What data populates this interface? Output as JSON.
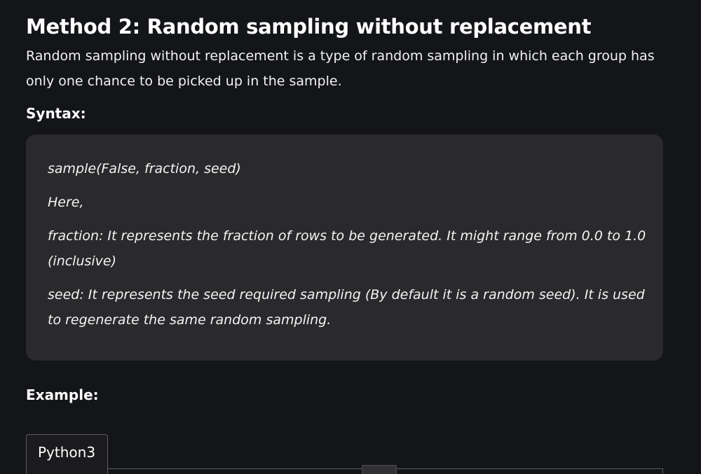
{
  "section": {
    "heading": "Method 2: Random sampling without replacement",
    "intro": "Random sampling without replacement is a type of random sampling in which each group has only one chance to be picked up in the sample."
  },
  "syntax": {
    "label": "Syntax:",
    "signature": "sample(False, fraction, seed)",
    "here": "Here,",
    "fraction_description": "fraction: It represents the fraction of rows to be generated.  It might range from 0.0 to 1.0 (inclusive)",
    "seed_description": "seed: It represents the seed required sampling (By default it is a random seed). It is used to regenerate the same random sampling."
  },
  "example": {
    "label": "Example:",
    "tab_label": "Python3"
  },
  "colors": {
    "page_background": "#141518",
    "syntax_box_background": "#2a2a2d",
    "tab_border": "#5b5b61",
    "text": "#ffffff"
  }
}
